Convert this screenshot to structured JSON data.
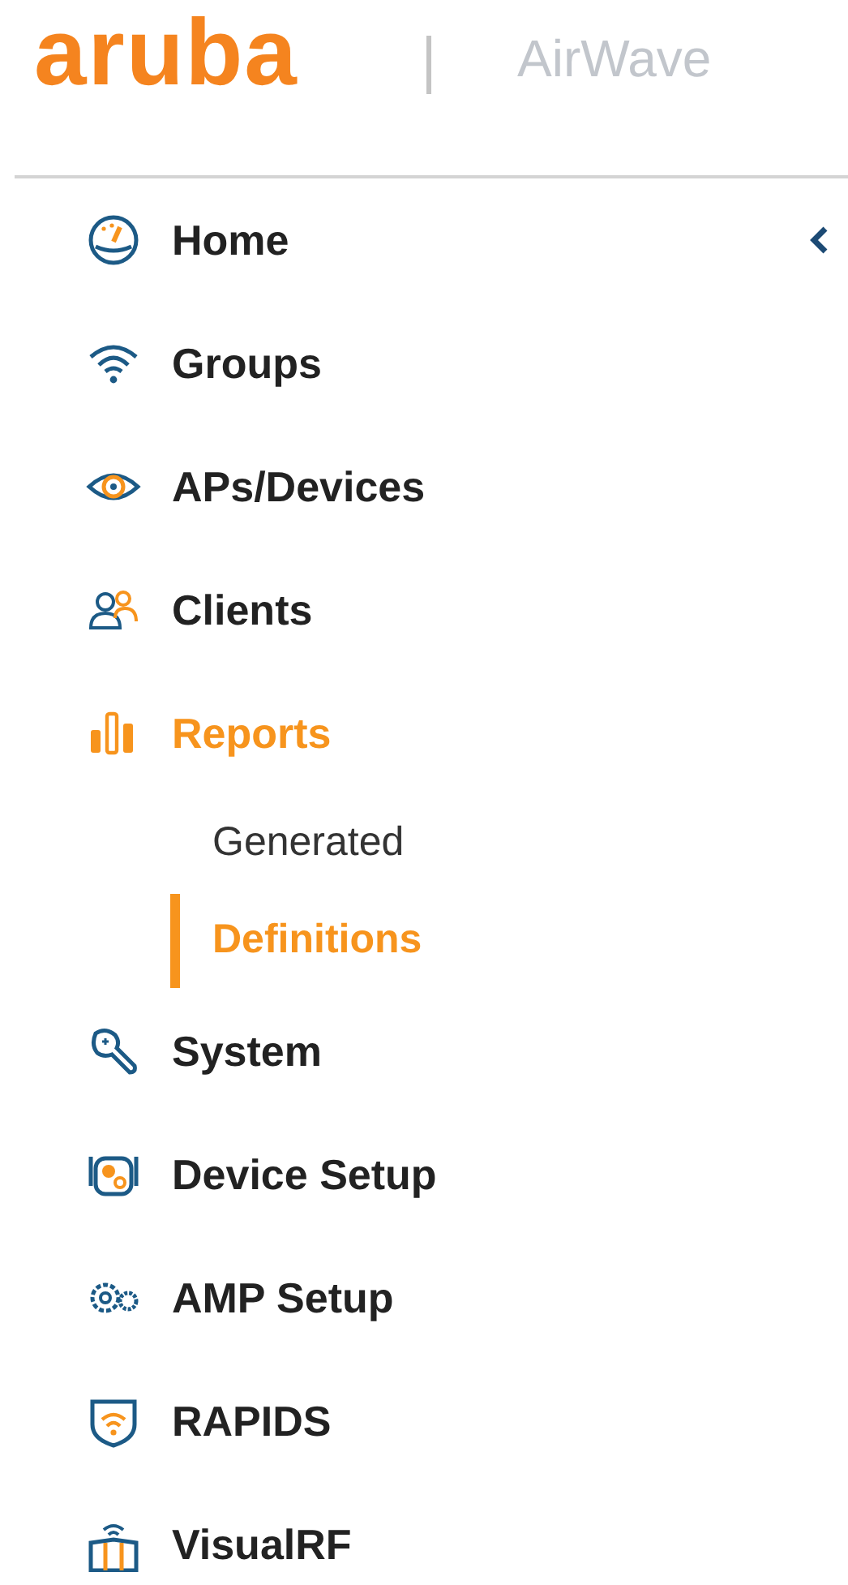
{
  "header": {
    "logo": "aruba",
    "product": "AirWave"
  },
  "nav": [
    {
      "label": "Home",
      "selected": false
    },
    {
      "label": "Groups",
      "selected": false
    },
    {
      "label": "APs/Devices",
      "selected": false
    },
    {
      "label": "Clients",
      "selected": false
    },
    {
      "label": "Reports",
      "selected": true,
      "children": [
        {
          "label": "Generated",
          "selected": false
        },
        {
          "label": "Definitions",
          "selected": true
        }
      ]
    },
    {
      "label": "System",
      "selected": false
    },
    {
      "label": "Device Setup",
      "selected": false
    },
    {
      "label": "AMP Setup",
      "selected": false
    },
    {
      "label": "RAPIDS",
      "selected": false
    },
    {
      "label": "VisualRF",
      "selected": false
    }
  ]
}
